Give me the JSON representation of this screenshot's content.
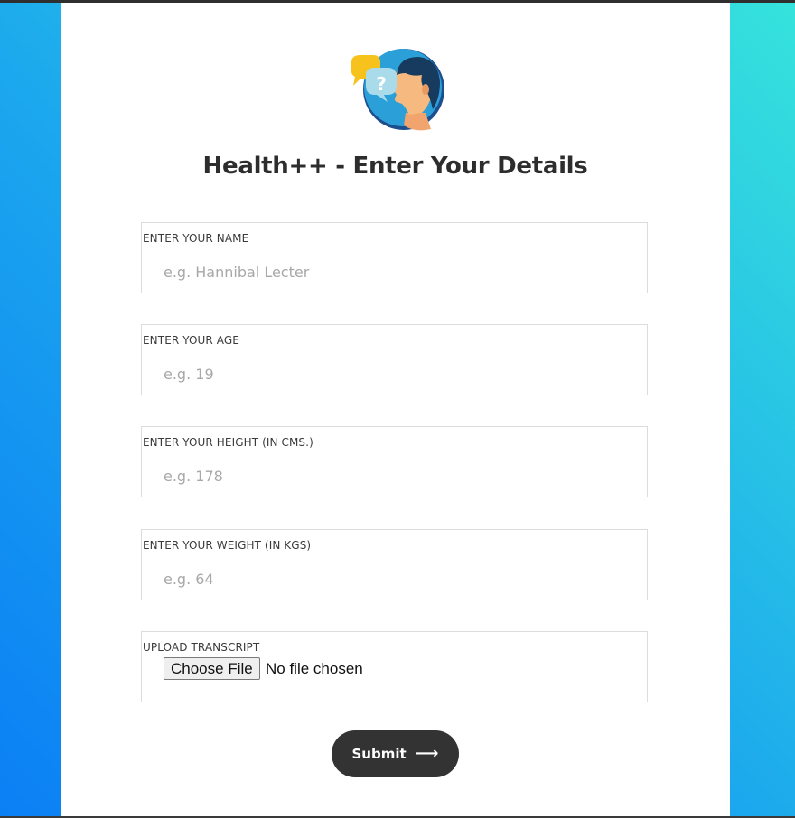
{
  "page": {
    "title": "Health++ - Enter Your Details",
    "logo_icon": "consultation-avatar-icon",
    "background_gradient": [
      "#0b7ff5",
      "#36e3dc"
    ]
  },
  "form": {
    "fields": [
      {
        "label": "ENTER YOUR NAME",
        "placeholder": "e.g. Hannibal Lecter",
        "value": ""
      },
      {
        "label": "ENTER YOUR AGE",
        "placeholder": "e.g. 19",
        "value": ""
      },
      {
        "label": "ENTER YOUR HEIGHT (IN CMS.)",
        "placeholder": "e.g. 178",
        "value": ""
      },
      {
        "label": "ENTER YOUR WEIGHT (IN KGS)",
        "placeholder": "e.g. 64",
        "value": ""
      }
    ],
    "upload": {
      "label": "UPLOAD TRANSCRIPT",
      "button_label": "Choose File",
      "status": "No file chosen"
    },
    "submit": {
      "label": "Submit",
      "icon": "arrow-right-icon"
    }
  }
}
